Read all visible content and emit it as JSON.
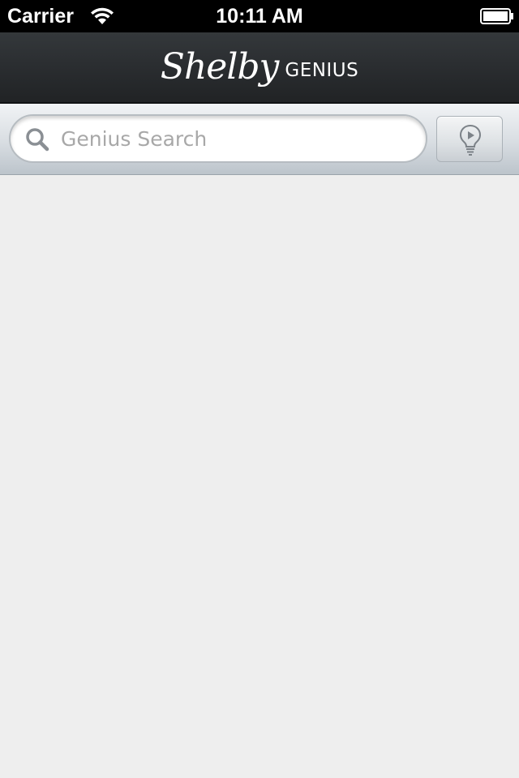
{
  "status_bar": {
    "carrier": "Carrier",
    "time": "10:11 AM",
    "wifi_icon": "wifi-icon",
    "battery_icon": "battery-icon"
  },
  "nav_bar": {
    "logo_script": "Shelby",
    "logo_sub": "GENIUS"
  },
  "search": {
    "placeholder": "Genius Search",
    "value": "",
    "search_icon": "search-icon",
    "bulb_button_icon": "lightbulb-play-icon"
  },
  "colors": {
    "status_bar_bg": "#000000",
    "nav_bar_bg": "#2a2d30",
    "content_bg": "#eeeeee",
    "placeholder_text": "#a8a8a8"
  }
}
